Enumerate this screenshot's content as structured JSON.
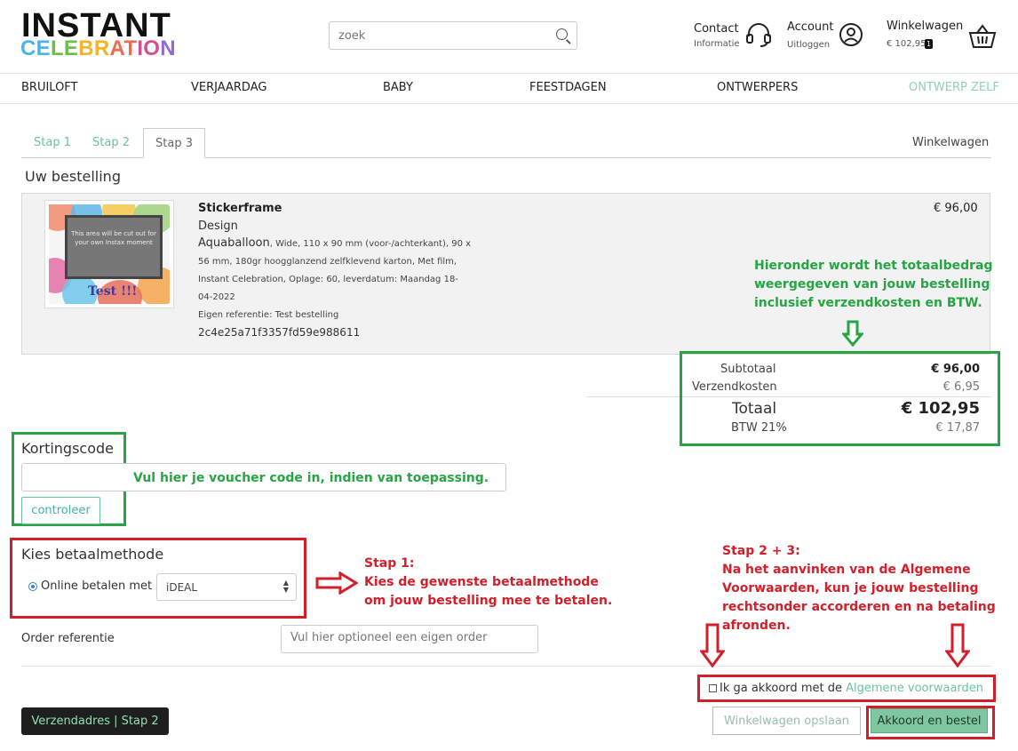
{
  "header": {
    "logo_top": "INSTANT",
    "logo_bottom": [
      "CE",
      "LE",
      "BR",
      "AT",
      "IO",
      "N"
    ],
    "search_placeholder": "zoek",
    "contact_title": "Contact",
    "contact_sub": "Informatie",
    "account_title": "Account",
    "account_sub": "Uitloggen",
    "cart_title": "Winkelwagen",
    "cart_amount": "€ 102,95",
    "cart_count": "1"
  },
  "nav": [
    "BRUILOFT",
    "VERJAARDAG",
    "BABY",
    "FEESTDAGEN",
    "ONTWERPERS",
    "ONTWERP ZELF"
  ],
  "tabs": [
    "Stap 1",
    "Stap 2",
    "Stap 3"
  ],
  "tabs_right": "Winkelwagen",
  "order_title": "Uw bestelling",
  "product": {
    "name": "Stickerframe",
    "type": "Design",
    "design_name": "Aquaballoon",
    "details_line1": ", Wide, 110 x 90 mm (voor-/achterkant), 90 x",
    "details_line2": "56 mm, 180gr hoogglanzend zelfklevend karton, Met film,",
    "details_line3": "Instant Celebration, Oplage: 60, leverdatum: Maandag 18-",
    "details_line4": "04-2022",
    "reference": "Eigen referentie: Test bestelling",
    "hash": "2c4e25a71f3357fd59e988611",
    "price": "€ 96,00",
    "thumb_text": "This area will be cut out for your own Instax moment",
    "thumb_test": "Test !!!"
  },
  "summary": {
    "subtotal_label": "Subtotaal",
    "subtotal_value": "€ 96,00",
    "shipping_label": "Verzendkosten",
    "shipping_value": "€ 6,95",
    "total_label": "Totaal",
    "total_value": "€ 102,95",
    "vat_label": "BTW 21%",
    "vat_value": "€ 17,87"
  },
  "discount": {
    "title": "Kortingscode",
    "button": "controleer"
  },
  "payment": {
    "title": "Kies betaalmethode",
    "option_label": "Online betalen met",
    "selected": "iDEAL"
  },
  "order_ref": {
    "label": "Order referentie",
    "placeholder": "Vul hier optioneel een eigen order"
  },
  "terms": {
    "text": "Ik ga akkoord met de",
    "link": "Algemene voorwaarden"
  },
  "buttons": {
    "save_cart": "Winkelwagen opslaan",
    "confirm": "Akkoord en bestel",
    "back": "Verzendadres | Stap 2"
  },
  "annotations": {
    "green_total": [
      "Hieronder wordt het totaalbedrag",
      "weergegeven van jouw bestelling",
      "inclusief verzendkosten en BTW."
    ],
    "green_voucher": "Vul hier je voucher code in, indien van toepassing.",
    "red_step1": [
      "Stap 1:",
      "Kies de gewenste betaalmethode",
      "om jouw bestelling mee te betalen."
    ],
    "red_step23": [
      "Stap 2 + 3:",
      "Na het aanvinken van de Algemene",
      "Voorwaarden, kun je jouw bestelling",
      "rechtsonder accorderen en na betaling",
      "afronden."
    ]
  },
  "colors": {
    "accent": "#6cc39b",
    "annotation_green": "#27a544",
    "annotation_red": "#d21f2a"
  }
}
